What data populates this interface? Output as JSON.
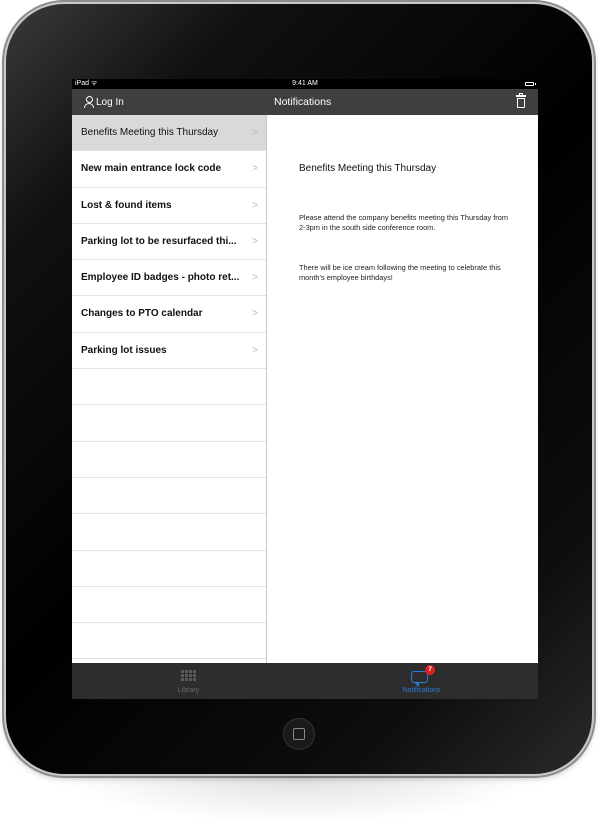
{
  "status_bar": {
    "device": "iPad ᯤ",
    "time": "9:41 AM"
  },
  "nav_bar": {
    "login_label": "Log In",
    "title": "Notifications"
  },
  "notifications": [
    {
      "title": "Benefits Meeting this Thursday"
    },
    {
      "title": "New main entrance lock code"
    },
    {
      "title": "Lost & found items"
    },
    {
      "title": "Parking lot to be resurfaced thi..."
    },
    {
      "title": "Employee ID badges - photo ret..."
    },
    {
      "title": "Changes to PTO calendar"
    },
    {
      "title": "Parking lot issues"
    }
  ],
  "chevron": ">",
  "detail": {
    "title": "Benefits Meeting this Thursday",
    "paragraph_1": "Please attend the company benefits meeting this Thursday from 2-3pm in the south side conference room.",
    "paragraph_2": "There will be ice cream following the meeting to celebrate this month's employee birthdays!"
  },
  "tabs": {
    "library_label": "Library",
    "notifications_label": "Notifications",
    "notifications_badge": "7"
  },
  "colors": {
    "nav_bar": "#3f3f3f",
    "tab_bar": "#2d2d2d",
    "selected_row": "#d9d9d9",
    "tab_active": "#2a7fd4",
    "tab_inactive": "#6a6a6a",
    "badge": "#e02020"
  },
  "icons": {
    "login": "person-icon",
    "delete": "trash-icon",
    "library": "grid-icon",
    "notifications": "chat-bubble-icon",
    "home": "home-button"
  }
}
